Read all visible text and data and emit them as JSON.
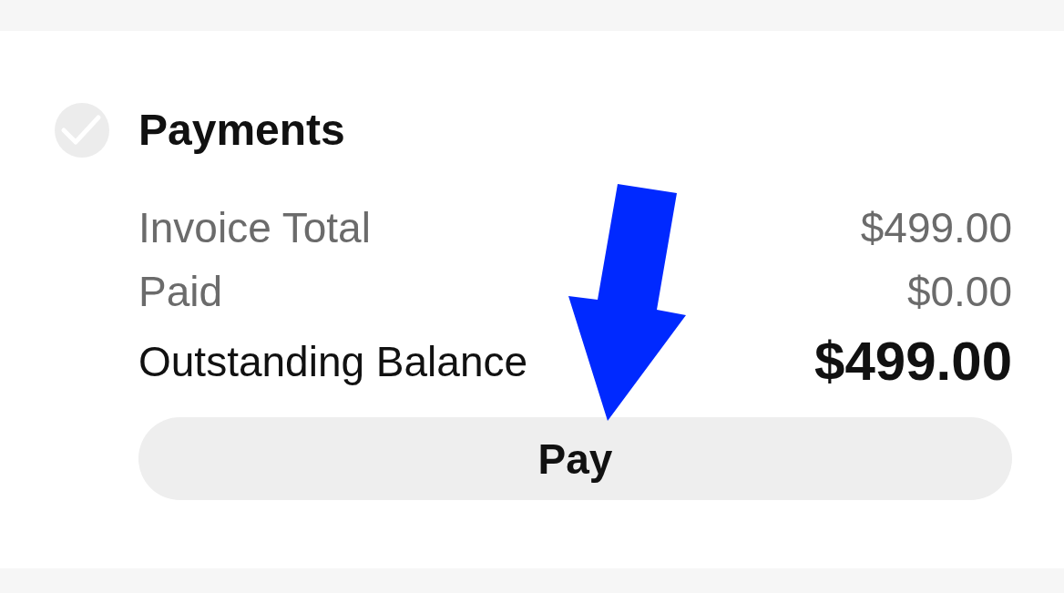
{
  "payments": {
    "title": "Payments",
    "rows": [
      {
        "kind": "normal",
        "label": "Invoice Total",
        "value": "$499.00"
      },
      {
        "kind": "normal",
        "label": "Paid",
        "value": "$0.00"
      },
      {
        "kind": "total",
        "label": "Outstanding Balance",
        "value": "$499.00"
      }
    ],
    "button": "Pay"
  }
}
